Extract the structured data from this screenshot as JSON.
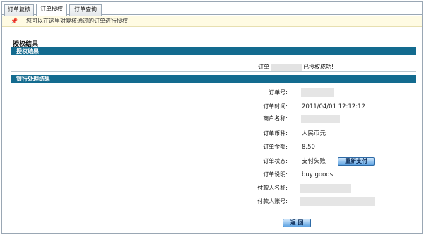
{
  "tabs": [
    {
      "label": "订单复核",
      "active": false
    },
    {
      "label": "订单授权",
      "active": true
    },
    {
      "label": "订单查询",
      "active": false
    }
  ],
  "hint": {
    "icon": "pin-icon",
    "text": "您可以在这里对复核通过的订单进行授权"
  },
  "page_title": "授权结果",
  "sections": {
    "auth_result": "授权结果",
    "bank_result": "银行处理结果"
  },
  "success": {
    "prefix": "订单",
    "suffix": "已授权成功!"
  },
  "details": {
    "order_no": {
      "label": "订单号:",
      "value": ""
    },
    "order_time": {
      "label": "订单时间:",
      "value": "2011/04/01 12:12:12"
    },
    "merchant": {
      "label": "商户名称:",
      "value": ""
    },
    "currency": {
      "label": "订单币种:",
      "value": "人民币元"
    },
    "amount": {
      "label": "订单金额:",
      "value": "8.50"
    },
    "status": {
      "label": "订单状态:",
      "value": "支付失败"
    },
    "desc": {
      "label": "订单说明:",
      "value": "buy goods"
    },
    "payer_name": {
      "label": "付款人名称:",
      "value": ""
    },
    "payer_account": {
      "label": "付款人账号:",
      "value": ""
    }
  },
  "buttons": {
    "repay": "重新支付",
    "back": "返  回"
  },
  "colors": {
    "section_bar": "#136b8f",
    "hint_bg": "#fffbe3",
    "button": "#5ea3e2"
  }
}
